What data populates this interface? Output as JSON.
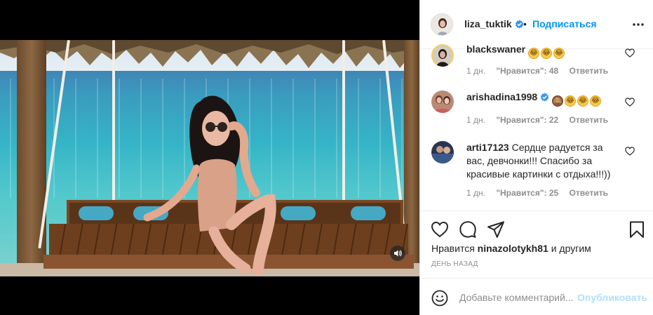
{
  "post": {
    "username": "liza_tuktik",
    "separator": "•",
    "follow_label": "Подписаться",
    "verified_icon": "verified-badge-icon",
    "more_icon": "more-options-icon"
  },
  "comments": [
    {
      "username": "blackswaner",
      "text": "",
      "emojis": [
        "😂",
        "😂",
        "😂"
      ],
      "time": "1 дн.",
      "likes": "\"Нравится\": 48",
      "reply": "Ответить"
    },
    {
      "username": "arishadina1998",
      "verified": true,
      "text": "",
      "emojis": [
        "🙈",
        "😂",
        "😂",
        "😂"
      ],
      "time": "1 дн.",
      "likes": "\"Нравится\": 22",
      "reply": "Ответить"
    },
    {
      "username": "arti17123",
      "text": "Сердце радуется за вас, девчонки!!! Спасибо за красивые картинки с отдыха!!!))",
      "time": "1 дн.",
      "likes": "\"Нравится\": 25",
      "reply": "Ответить"
    }
  ],
  "likes_summary": {
    "prefix": "Нравится",
    "user": "ninazolotykh81",
    "suffix": "и другим"
  },
  "date_label": "ДЕНЬ НАЗАД",
  "add_comment": {
    "placeholder": "Добавьте комментарий...",
    "publish_label": "Опубликовать"
  },
  "colors": {
    "accent": "#0095f6",
    "publish_disabled": "#b2dffc",
    "secondary_text": "#8e8e8e"
  }
}
